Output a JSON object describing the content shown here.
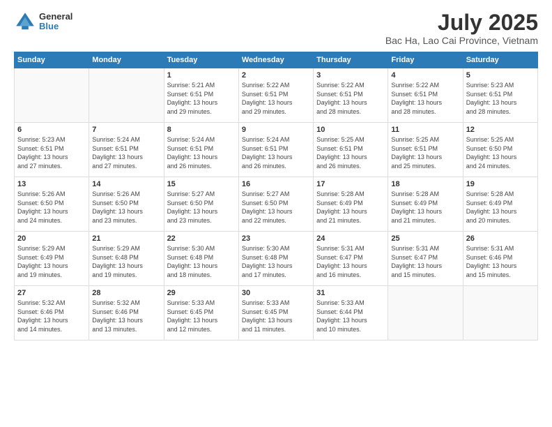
{
  "header": {
    "logo_general": "General",
    "logo_blue": "Blue",
    "month_title": "July 2025",
    "location": "Bac Ha, Lao Cai Province, Vietnam"
  },
  "weekdays": [
    "Sunday",
    "Monday",
    "Tuesday",
    "Wednesday",
    "Thursday",
    "Friday",
    "Saturday"
  ],
  "weeks": [
    [
      {
        "day": "",
        "empty": true
      },
      {
        "day": "",
        "empty": true
      },
      {
        "day": "1",
        "sunrise": "5:21 AM",
        "sunset": "6:51 PM",
        "daylight": "13 hours and 29 minutes."
      },
      {
        "day": "2",
        "sunrise": "5:22 AM",
        "sunset": "6:51 PM",
        "daylight": "13 hours and 29 minutes."
      },
      {
        "day": "3",
        "sunrise": "5:22 AM",
        "sunset": "6:51 PM",
        "daylight": "13 hours and 28 minutes."
      },
      {
        "day": "4",
        "sunrise": "5:22 AM",
        "sunset": "6:51 PM",
        "daylight": "13 hours and 28 minutes."
      },
      {
        "day": "5",
        "sunrise": "5:23 AM",
        "sunset": "6:51 PM",
        "daylight": "13 hours and 28 minutes."
      }
    ],
    [
      {
        "day": "6",
        "sunrise": "5:23 AM",
        "sunset": "6:51 PM",
        "daylight": "13 hours and 27 minutes."
      },
      {
        "day": "7",
        "sunrise": "5:24 AM",
        "sunset": "6:51 PM",
        "daylight": "13 hours and 27 minutes."
      },
      {
        "day": "8",
        "sunrise": "5:24 AM",
        "sunset": "6:51 PM",
        "daylight": "13 hours and 26 minutes."
      },
      {
        "day": "9",
        "sunrise": "5:24 AM",
        "sunset": "6:51 PM",
        "daylight": "13 hours and 26 minutes."
      },
      {
        "day": "10",
        "sunrise": "5:25 AM",
        "sunset": "6:51 PM",
        "daylight": "13 hours and 26 minutes."
      },
      {
        "day": "11",
        "sunrise": "5:25 AM",
        "sunset": "6:51 PM",
        "daylight": "13 hours and 25 minutes."
      },
      {
        "day": "12",
        "sunrise": "5:25 AM",
        "sunset": "6:50 PM",
        "daylight": "13 hours and 24 minutes."
      }
    ],
    [
      {
        "day": "13",
        "sunrise": "5:26 AM",
        "sunset": "6:50 PM",
        "daylight": "13 hours and 24 minutes."
      },
      {
        "day": "14",
        "sunrise": "5:26 AM",
        "sunset": "6:50 PM",
        "daylight": "13 hours and 23 minutes."
      },
      {
        "day": "15",
        "sunrise": "5:27 AM",
        "sunset": "6:50 PM",
        "daylight": "13 hours and 23 minutes."
      },
      {
        "day": "16",
        "sunrise": "5:27 AM",
        "sunset": "6:50 PM",
        "daylight": "13 hours and 22 minutes."
      },
      {
        "day": "17",
        "sunrise": "5:28 AM",
        "sunset": "6:49 PM",
        "daylight": "13 hours and 21 minutes."
      },
      {
        "day": "18",
        "sunrise": "5:28 AM",
        "sunset": "6:49 PM",
        "daylight": "13 hours and 21 minutes."
      },
      {
        "day": "19",
        "sunrise": "5:28 AM",
        "sunset": "6:49 PM",
        "daylight": "13 hours and 20 minutes."
      }
    ],
    [
      {
        "day": "20",
        "sunrise": "5:29 AM",
        "sunset": "6:49 PM",
        "daylight": "13 hours and 19 minutes."
      },
      {
        "day": "21",
        "sunrise": "5:29 AM",
        "sunset": "6:48 PM",
        "daylight": "13 hours and 19 minutes."
      },
      {
        "day": "22",
        "sunrise": "5:30 AM",
        "sunset": "6:48 PM",
        "daylight": "13 hours and 18 minutes."
      },
      {
        "day": "23",
        "sunrise": "5:30 AM",
        "sunset": "6:48 PM",
        "daylight": "13 hours and 17 minutes."
      },
      {
        "day": "24",
        "sunrise": "5:31 AM",
        "sunset": "6:47 PM",
        "daylight": "13 hours and 16 minutes."
      },
      {
        "day": "25",
        "sunrise": "5:31 AM",
        "sunset": "6:47 PM",
        "daylight": "13 hours and 15 minutes."
      },
      {
        "day": "26",
        "sunrise": "5:31 AM",
        "sunset": "6:46 PM",
        "daylight": "13 hours and 15 minutes."
      }
    ],
    [
      {
        "day": "27",
        "sunrise": "5:32 AM",
        "sunset": "6:46 PM",
        "daylight": "13 hours and 14 minutes."
      },
      {
        "day": "28",
        "sunrise": "5:32 AM",
        "sunset": "6:46 PM",
        "daylight": "13 hours and 13 minutes."
      },
      {
        "day": "29",
        "sunrise": "5:33 AM",
        "sunset": "6:45 PM",
        "daylight": "13 hours and 12 minutes."
      },
      {
        "day": "30",
        "sunrise": "5:33 AM",
        "sunset": "6:45 PM",
        "daylight": "13 hours and 11 minutes."
      },
      {
        "day": "31",
        "sunrise": "5:33 AM",
        "sunset": "6:44 PM",
        "daylight": "13 hours and 10 minutes."
      },
      {
        "day": "",
        "empty": true
      },
      {
        "day": "",
        "empty": true
      }
    ]
  ]
}
